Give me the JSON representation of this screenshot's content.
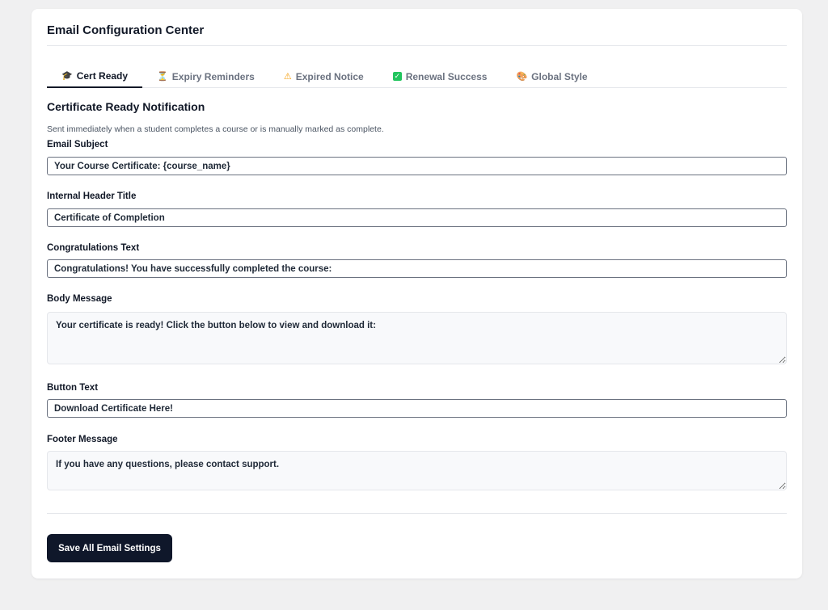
{
  "page": {
    "title": "Email Configuration Center"
  },
  "tabs": [
    {
      "label": "Cert Ready",
      "icon": "graduation-cap-icon",
      "glyph": "🎓",
      "active": true
    },
    {
      "label": "Expiry Reminders",
      "icon": "hourglass-icon",
      "glyph": "⏳",
      "active": false
    },
    {
      "label": "Expired Notice",
      "icon": "warning-icon",
      "glyph": "⚠",
      "active": false
    },
    {
      "label": "Renewal Success",
      "icon": "check-box-icon",
      "glyph": "✓",
      "active": false
    },
    {
      "label": "Global Style",
      "icon": "palette-icon",
      "glyph": "🎨",
      "active": false
    }
  ],
  "section": {
    "title": "Certificate Ready Notification",
    "description": "Sent immediately when a student completes a course or is manually marked as complete."
  },
  "fields": {
    "email_subject": {
      "label": "Email Subject",
      "value": "Your Course Certificate: {course_name}"
    },
    "header_title": {
      "label": "Internal Header Title",
      "value": "Certificate of Completion"
    },
    "congrats_text": {
      "label": "Congratulations Text",
      "value": "Congratulations! You have successfully completed the course:"
    },
    "body_message": {
      "label": "Body Message",
      "value": "Your certificate is ready! Click the button below to view and download it:"
    },
    "button_text": {
      "label": "Button Text",
      "value": "Download Certificate Here!"
    },
    "footer_message": {
      "label": "Footer Message",
      "value": "If you have any questions, please contact support."
    }
  },
  "actions": {
    "save_label": "Save All Email Settings"
  },
  "colors": {
    "background": "#f0f0f1",
    "card": "#ffffff",
    "primary_button": "#0f172a",
    "active_tab": "#111827",
    "inactive_tab": "#6b7280"
  }
}
